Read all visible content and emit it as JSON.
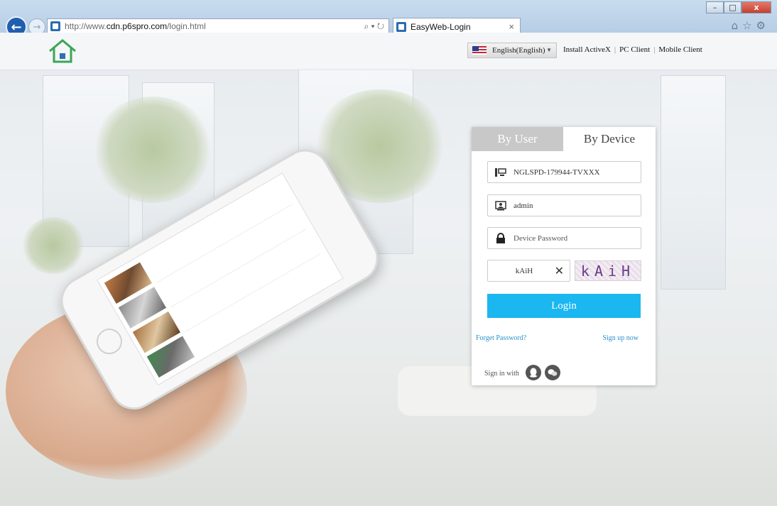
{
  "browser": {
    "url_prefix": "http://www.",
    "url_domain": "cdn.p6spro.com",
    "url_suffix": "/login.html",
    "address_controls": "⌕ ▾ ↻",
    "tab_title": "EasyWeb-Login",
    "tab_close": "×",
    "window_buttons": {
      "minimize": "–",
      "maximize": "□",
      "close": "x"
    },
    "toolbar_icons": "⌂☆⚙"
  },
  "header": {
    "language": "English(English)",
    "language_arrow": "▼",
    "links": [
      "Install ActiveX",
      "PC Client",
      "Mobile Client"
    ],
    "separator": "|"
  },
  "login": {
    "tabs": {
      "by_user": "By User",
      "by_device": "By Device"
    },
    "active_tab": "by_device",
    "device_id": "NGLSPD-179944-TVXXX",
    "username": "admin",
    "password_placeholder": "Device Password",
    "captcha_input": "kAiH",
    "captcha_clear": "✕",
    "captcha_image_text": "kAiH",
    "login_button": "Login",
    "forget_password": "Forget Password?",
    "sign_up": "Sign up now",
    "sign_in_with": "Sign in with"
  },
  "colors": {
    "accent": "#1ab7f1",
    "link": "#2a93c8",
    "tab_inactive": "#c8c8c8",
    "logo_green": "#3aa655"
  },
  "icons": {
    "device": "device-icon",
    "user": "user-icon",
    "password": "lock-icon",
    "qq": "qq-icon",
    "wechat": "wechat-icon",
    "logo": "house-logo-icon"
  }
}
